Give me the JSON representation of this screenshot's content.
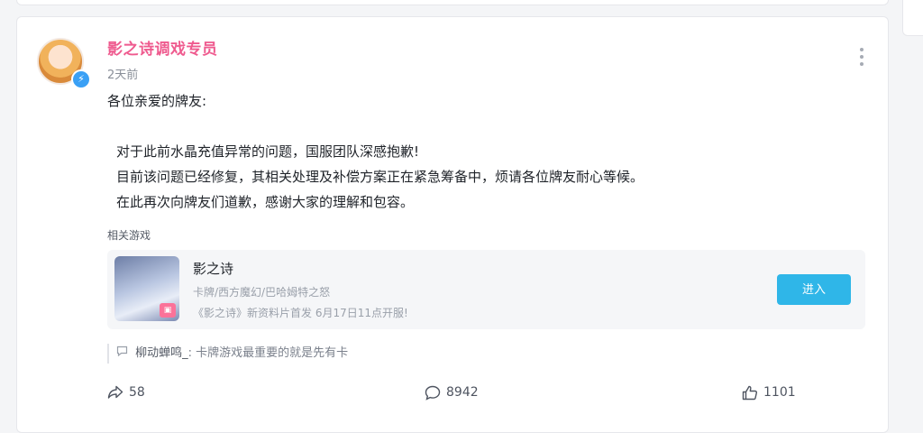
{
  "post": {
    "author": "影之诗调戏专员",
    "time": "2天前",
    "greeting": "各位亲爱的牌友:",
    "paragraphs": [
      "对于此前水晶充值异常的问题，国服团队深感抱歉!",
      "目前该问题已经修复，其相关处理及补偿方案正在紧急筹备中，烦请各位牌友耐心等候。",
      "在此再次向牌友们道歉，感谢大家的理解和包容。"
    ]
  },
  "related": {
    "title": "相关游戏",
    "game": {
      "name": "影之诗",
      "tags": "卡牌/西方魔幻/巴哈姆特之怒",
      "news": "《影之诗》新资料片首发 6月17日11点开服!",
      "button": "进入"
    }
  },
  "comment": {
    "user": "柳动蝉鸣_",
    "text": ": 卡牌游戏最重要的就是先有卡"
  },
  "stats": {
    "shares": "58",
    "replies": "8942",
    "likes": "1101"
  },
  "colors": {
    "author": "#ef5b8f",
    "button": "#2fb6e8",
    "verified": "#3aa0f5"
  }
}
